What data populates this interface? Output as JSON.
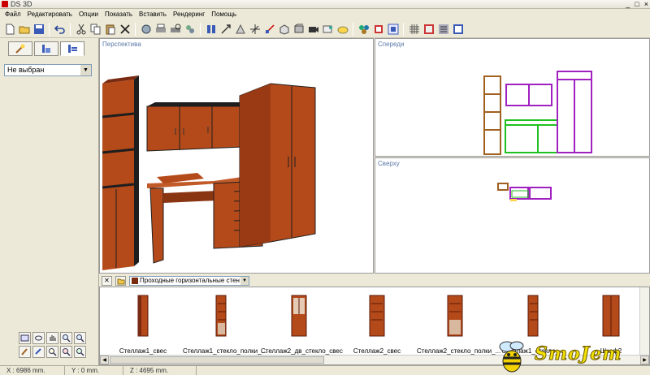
{
  "window": {
    "title": "DS 3D",
    "controls": [
      "_",
      "□",
      "×"
    ]
  },
  "menu": [
    "Файл",
    "Редактировать",
    "Опции",
    "Показать",
    "Вставить",
    "Рендеринг",
    "Помощь"
  ],
  "toolbar": {
    "icons": [
      "new-icon",
      "open-icon",
      "save-icon",
      "undo-icon",
      "cut-icon",
      "copy-icon",
      "paste-icon",
      "delete-icon",
      "render-icon",
      "print-icon",
      "print-preview-icon",
      "export-icon",
      "layout-icon",
      "move-icon",
      "rotate-icon",
      "axes-icon",
      "scale-icon",
      "box-icon",
      "wall-icon",
      "camera-icon",
      "material-icon",
      "light-icon",
      "texture-icon",
      "group-icon",
      "ungroup-icon",
      "grid-icon",
      "snap-icon",
      "properties-icon",
      "help-icon"
    ]
  },
  "left_panel": {
    "tabs": [
      "brush-icon",
      "furniture-icon",
      "settings-icon"
    ],
    "selection": "Не выбран"
  },
  "views": {
    "perspective": "Перспектива",
    "front": "Спереди",
    "top": "Сверху"
  },
  "catalog": {
    "category": "Проходные горизонтальные стен",
    "items": [
      {
        "label": "Стеллаж1_свес"
      },
      {
        "label": "Стеллаж1_стекло_полки_..."
      },
      {
        "label": "Стеллаж2_дв_стекло_свес"
      },
      {
        "label": "Стеллаж2_свес"
      },
      {
        "label": "Стеллаж2_стекло_полки_..."
      },
      {
        "label": "Стеллаж1_стекло_..."
      },
      {
        "label": "Шкаф2"
      }
    ]
  },
  "status": {
    "x": "X : 6986 mm.",
    "y": "Y : 0 mm.",
    "z": "Z : 4695 mm."
  },
  "watermark": "SmoJem",
  "colors": {
    "wood": "#b44a1a",
    "wood_dark": "#7a2a10",
    "view_label": "#5a78a8",
    "outline_magenta": "#a020c0",
    "outline_green": "#20c020",
    "outline_brown": "#a06020"
  }
}
